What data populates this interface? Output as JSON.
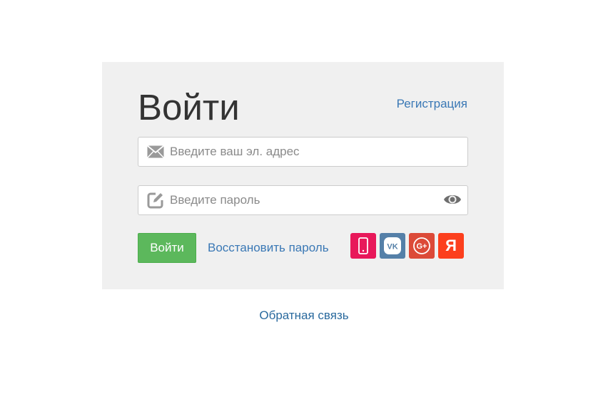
{
  "login_form": {
    "title": "Войти",
    "register_link": "Регистрация",
    "email": {
      "value": "",
      "placeholder": "Введите ваш эл. адрес",
      "icon": "envelope-icon"
    },
    "password": {
      "value": "",
      "placeholder": "Введите пароль",
      "icon": "edit-pencil-icon",
      "toggle_icon": "eye-icon"
    },
    "submit_label": "Войти",
    "restore_link": "Восстановить пароль",
    "social": [
      {
        "name": "phone",
        "icon": "phone-icon",
        "color": "#e8185a"
      },
      {
        "name": "vk",
        "label": "VK",
        "icon": "vk-icon",
        "color": "#5580a8"
      },
      {
        "name": "google-plus",
        "label": "G+",
        "icon": "google-plus-icon",
        "color": "#dc4a38"
      },
      {
        "name": "yandex",
        "label": "Я",
        "icon": "yandex-icon",
        "color": "#fc3f1d"
      }
    ]
  },
  "footer": {
    "feedback_link": "Обратная связь"
  },
  "colors": {
    "panel_bg": "#f0f0f0",
    "link": "#3a78b5",
    "button_green": "#5cb85c"
  }
}
